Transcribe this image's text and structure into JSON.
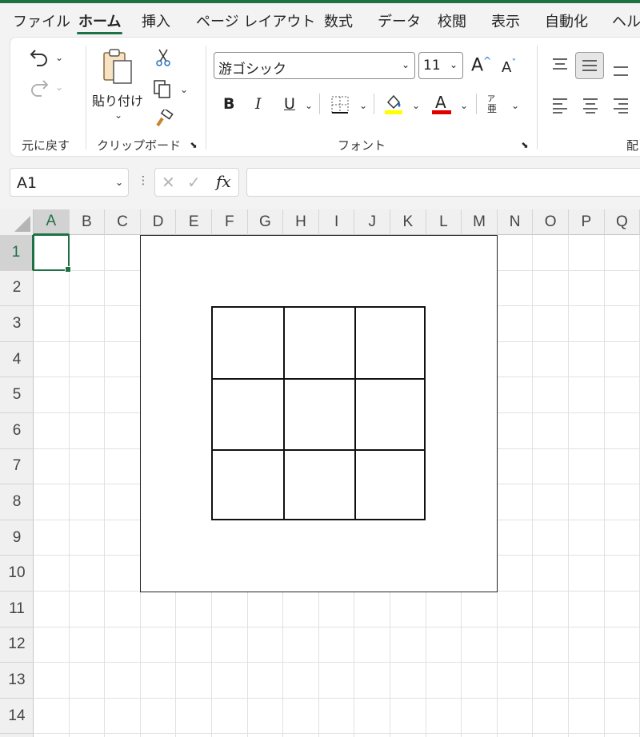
{
  "tabs": [
    {
      "label": "ファイル",
      "active": false
    },
    {
      "label": "ホーム",
      "active": true
    },
    {
      "label": "挿入",
      "active": false
    },
    {
      "label": "ページ レイアウト",
      "active": false
    },
    {
      "label": "数式",
      "active": false
    },
    {
      "label": "データ",
      "active": false
    },
    {
      "label": "校閲",
      "active": false
    },
    {
      "label": "表示",
      "active": false
    },
    {
      "label": "自動化",
      "active": false
    },
    {
      "label": "ヘル",
      "active": false
    }
  ],
  "ribbon": {
    "undo_group": {
      "label": "元に戻す",
      "undo_icon": "undo-icon",
      "redo_icon": "redo-icon"
    },
    "clipboard": {
      "label": "クリップボード",
      "paste_label": "貼り付け",
      "cut_icon": "scissors-icon",
      "copy_icon": "copy-icon",
      "painter_icon": "format-painter-icon"
    },
    "font": {
      "label": "フォント",
      "font_name": "游ゴシック",
      "font_size": "11",
      "grow": "A",
      "shrink": "A",
      "bold": "B",
      "italic": "I",
      "underline": "U",
      "font_color_letter": "A",
      "phonetic_top": "ア",
      "phonetic_bottom": "亜",
      "fill_color": "#ffff00",
      "font_color": "#e00000"
    },
    "alignment": {
      "label": "配"
    }
  },
  "formula_bar": {
    "name_box": "A1",
    "cancel_icon": "✕",
    "enter_icon": "✓",
    "fx": "fx",
    "formula": ""
  },
  "grid": {
    "columns": [
      "A",
      "B",
      "C",
      "D",
      "E",
      "F",
      "G",
      "H",
      "I",
      "J",
      "K",
      "L",
      "M",
      "N",
      "O",
      "P",
      "Q"
    ],
    "rows": [
      "1",
      "2",
      "3",
      "4",
      "5",
      "6",
      "7",
      "8",
      "9",
      "10",
      "11",
      "12",
      "13",
      "14"
    ],
    "selected_column": "A",
    "selected_row": "1"
  },
  "accent_color": "#1e7145"
}
